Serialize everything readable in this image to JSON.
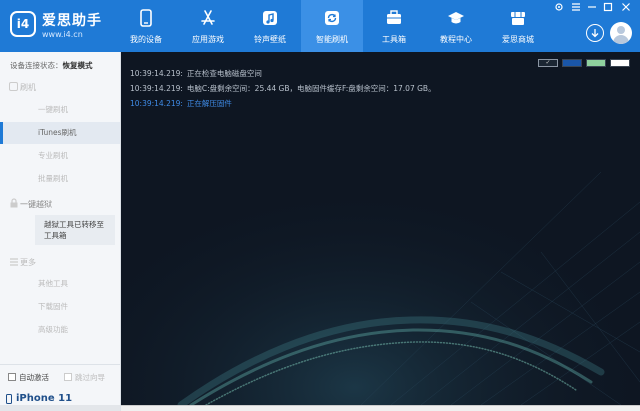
{
  "app": {
    "logo_badge": "i4",
    "name": "爱思助手",
    "url": "www.i4.cn"
  },
  "nav": {
    "items": [
      {
        "label": "我的设备",
        "icon": "phone-icon"
      },
      {
        "label": "应用游戏",
        "icon": "app-store-icon"
      },
      {
        "label": "铃声壁纸",
        "icon": "music-icon"
      },
      {
        "label": "智能刷机",
        "icon": "refresh-icon"
      },
      {
        "label": "工具箱",
        "icon": "toolbox-icon"
      },
      {
        "label": "教程中心",
        "icon": "graduation-cap-icon"
      },
      {
        "label": "爱思商城",
        "icon": "store-icon"
      }
    ],
    "active_index": 3
  },
  "sidebar": {
    "status_label": "设备连接状态：",
    "status_value": "恢复模式",
    "flash_section": "刷机",
    "flash_items": [
      "一键刷机",
      "iTunes刷机",
      "专业刷机",
      "批量刷机"
    ],
    "active_item": "iTunes刷机",
    "jailbreak_section": "一键越狱",
    "jailbreak_note": "越狱工具已转移至工具箱",
    "more_section": "更多",
    "more_items": [
      "其他工具",
      "下载固件",
      "高级功能"
    ],
    "auto_activate": "自动激活",
    "skip_guide": "跳过向导",
    "device_name": "iPhone 11"
  },
  "console": {
    "swatch_colors": [
      "#1b2633",
      "#1a56a8",
      "#8fd19e",
      "#ffffff"
    ],
    "logs": [
      {
        "time": "10:39:14.219:",
        "text": "正在检查电脑磁盘空间",
        "highlight": false
      },
      {
        "time": "10:39:14.219:",
        "text": "电脑C:盘剩余空间：25.44 GB，电脑固件缓存F:盘剩余空间：17.07 GB。",
        "highlight": false
      },
      {
        "time": "10:39:14.219:",
        "text": "正在解压固件",
        "highlight": true
      }
    ]
  },
  "colors": {
    "brand": "#1f7ad6",
    "log_highlight": "#3f8be6",
    "console_bg": "#0e1622"
  }
}
